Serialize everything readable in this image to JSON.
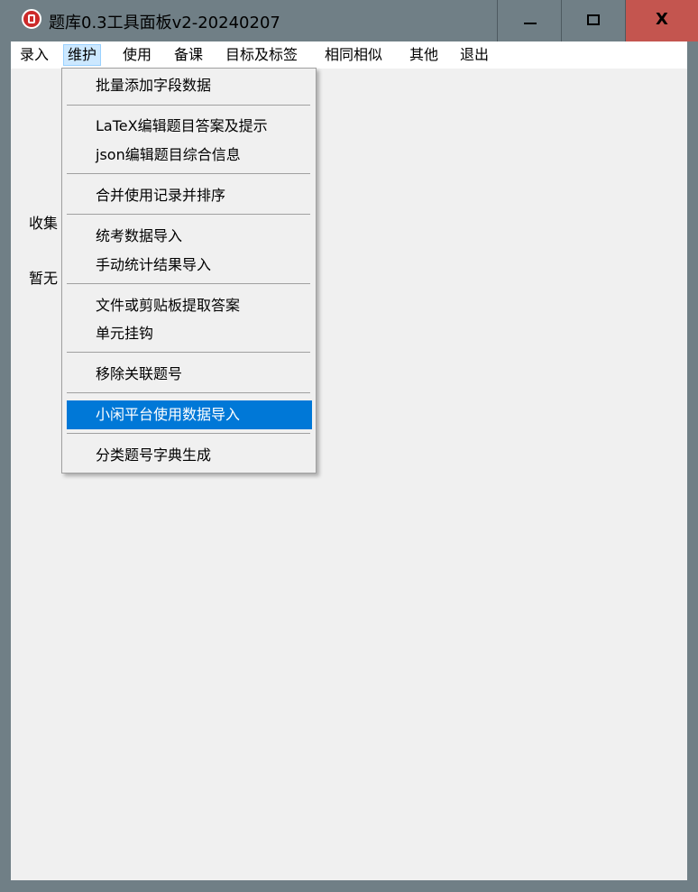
{
  "window": {
    "title": "题库0.3工具面板v2-20240207",
    "icon": "app-logo-icon",
    "controls": {
      "minimize_icon": "minimize-icon",
      "maximize_icon": "maximize-icon",
      "close_label": "X"
    },
    "colors": {
      "frame": "#707f86",
      "close_button": "#c4554f",
      "client": "#f0f0f0",
      "highlight": "#0078d7"
    }
  },
  "menubar": {
    "items": [
      "录入",
      "维护",
      "使用",
      "备课",
      "目标及标签",
      "相同相似",
      "其他",
      "退出"
    ],
    "active": "维护"
  },
  "background_labels": [
    "收集",
    "暂无"
  ],
  "dropdown": {
    "items": [
      "批量添加字段数据",
      "LaTeX编辑题目答案及提示",
      "json编辑题目综合信息",
      "合并使用记录并排序",
      "统考数据导入",
      "手动统计结果导入",
      "文件或剪贴板提取答案",
      "单元挂钩",
      "移除关联题号",
      "小闲平台使用数据导入",
      "分类题号字典生成"
    ],
    "highlighted": "小闲平台使用数据导入"
  }
}
